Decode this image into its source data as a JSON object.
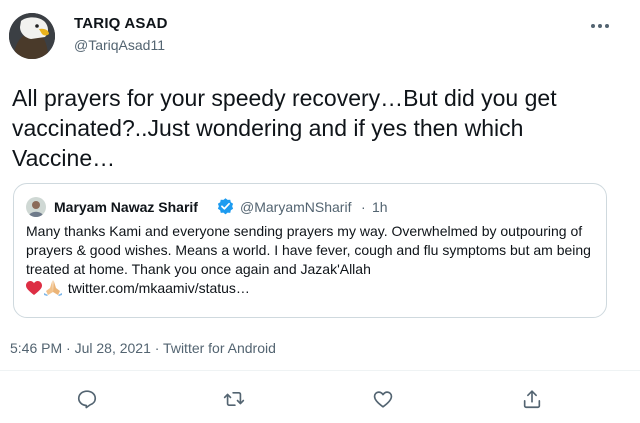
{
  "tweet": {
    "author_name": "TARIQ ASAD",
    "author_handle": "@TariqAsad11",
    "text": "All prayers for your speedy recovery…But did you get vaccinated?..Just wondering and if yes then which Vaccine…",
    "timestamp": "5:46 PM · Jul 28, 2021 · Twitter for Android"
  },
  "quoted": {
    "author_name": "Maryam Nawaz Sharif",
    "author_handle": "@MaryamNSharif",
    "separator": "·",
    "time": "1h",
    "text": "Many thanks Kami and everyone sending prayers my way. Overwhelmed by outpouring of prayers & good wishes. Means a world. I have fever, cough and flu symptoms but am being treated at home. Thank you once again and Jazak'Allah",
    "link": "twitter.com/mkaamiv/status…"
  },
  "icons": {
    "more": "more-horizontal-icon",
    "reply": "reply-icon",
    "retweet": "retweet-icon",
    "like": "heart-icon",
    "share": "share-icon",
    "verified": "verified-badge-icon"
  },
  "colors": {
    "text": "#0f1419",
    "secondary": "#536471",
    "verified": "#1d9bf0",
    "border": "#cfd9de"
  }
}
